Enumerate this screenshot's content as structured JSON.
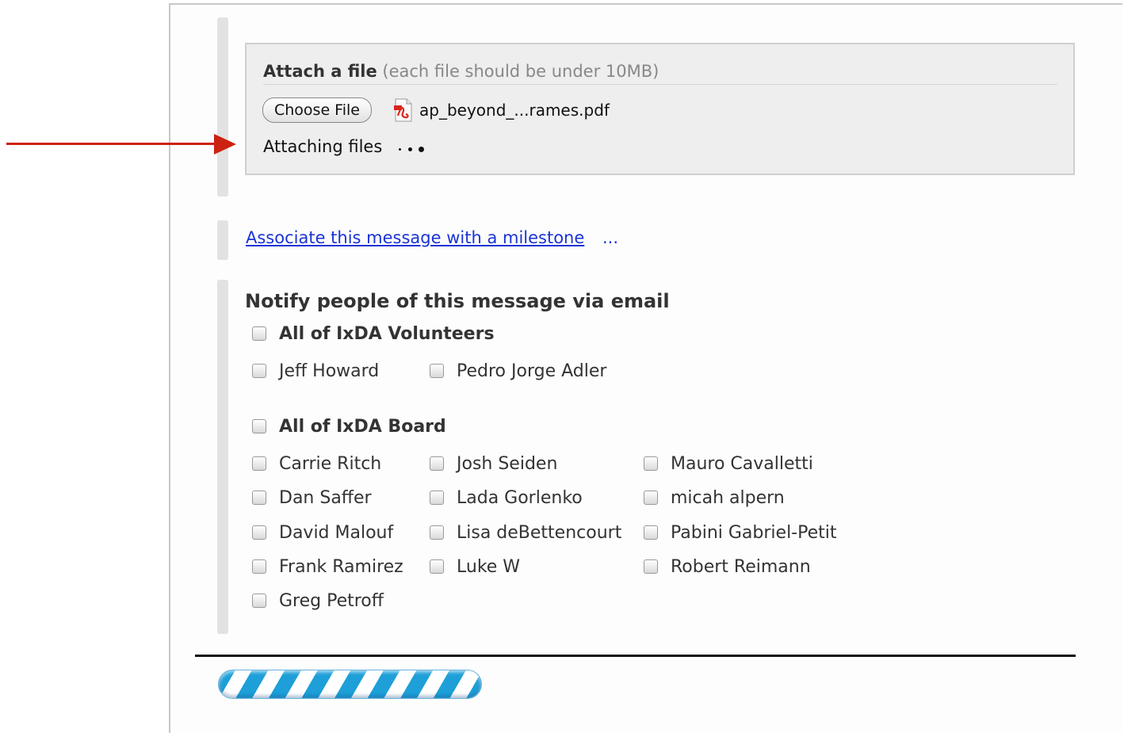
{
  "attach": {
    "title_bold": "Attach a file",
    "title_note": "(each file should be under 10MB)",
    "choose_button": "Choose File",
    "file_name": "ap_beyond_...rames.pdf",
    "status": "Attaching files"
  },
  "milestone": {
    "link_text": "Associate this message with a milestone",
    "ellipsis": "..."
  },
  "notify": {
    "title": "Notify people of this message via email",
    "groups": [
      {
        "label": "All of IxDA Volunteers",
        "checked": false,
        "members": [
          {
            "label": "Jeff Howard",
            "checked": false
          },
          {
            "label": "Pedro Jorge Adler",
            "checked": false
          }
        ]
      },
      {
        "label": "All of IxDA Board",
        "checked": false,
        "members": [
          {
            "label": "Carrie Ritch",
            "checked": false
          },
          {
            "label": "Josh Seiden",
            "checked": false
          },
          {
            "label": "Mauro Cavalletti",
            "checked": false
          },
          {
            "label": "Dan Saffer",
            "checked": false
          },
          {
            "label": "Lada Gorlenko",
            "checked": false
          },
          {
            "label": "micah alpern",
            "checked": false
          },
          {
            "label": "David Malouf",
            "checked": false
          },
          {
            "label": "Lisa deBettencourt",
            "checked": false
          },
          {
            "label": "Pabini Gabriel-Petit",
            "checked": false
          },
          {
            "label": "Frank Ramirez",
            "checked": false
          },
          {
            "label": "Luke W",
            "checked": false
          },
          {
            "label": "Robert Reimann",
            "checked": false
          },
          {
            "label": "Greg Petroff",
            "checked": false
          }
        ]
      }
    ]
  },
  "icons": {
    "pointer": "red-arrow-icon",
    "file": "pdf-file-icon",
    "busy": "loading-dots-icon"
  },
  "colors": {
    "arrow": "#cc2211",
    "link": "#1a33d6",
    "progress": "#1e9fd8"
  }
}
